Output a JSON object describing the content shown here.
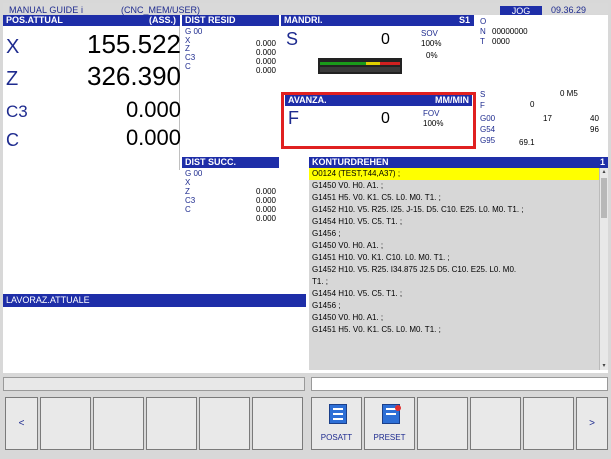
{
  "titlebar": {
    "title": "MANUAL GUIDE i",
    "mode": "(CNC_MEM/USER)",
    "jog": "JOG",
    "time": "09.36.29"
  },
  "pos": {
    "header": "POS.ATTUAL",
    "subheader": "(ASS.)",
    "axes": [
      {
        "label": "X",
        "value": "155.522"
      },
      {
        "label": "Z",
        "value": "326.390"
      },
      {
        "label": "C3",
        "value": "0.000"
      },
      {
        "label": "C",
        "value": "0.000"
      }
    ]
  },
  "dist_resid": {
    "header": "DIST RESID",
    "g": "G 00",
    "rows": [
      {
        "label": "X",
        "value": "0.000"
      },
      {
        "label": "Z",
        "value": "0.000"
      },
      {
        "label": "C3",
        "value": "0.000"
      },
      {
        "label": "C",
        "value": "0.000"
      }
    ]
  },
  "mandri": {
    "header": "MANDRI.",
    "s1": "S1",
    "s_label": "S",
    "s_value": "0",
    "sov": "SOV",
    "sov_pct": "100%",
    "load_pct": "0%"
  },
  "feed": {
    "header": "AVANZA.",
    "unit": "MM/MIN",
    "f_label": "F",
    "f_value": "0",
    "fov": "FOV",
    "fov_pct": "100%"
  },
  "right_info": {
    "o": "O",
    "n_label": "N",
    "n_value": "00000000",
    "t_label": "T",
    "t_value": "0000",
    "s_label": "S",
    "m_label": "0  M5",
    "f_label": "F",
    "f_value": "0",
    "g00": "G00",
    "v17": "17",
    "v40": "40",
    "g54": "G54",
    "v96": "96",
    "g95": "G95",
    "v691": "69.1"
  },
  "dist_succ": {
    "header": "DIST SUCC.",
    "g": "G 00",
    "rows": [
      {
        "label": "X",
        "value": "0.000"
      },
      {
        "label": "Z",
        "value": "0.000"
      },
      {
        "label": "C3",
        "value": "0.000"
      },
      {
        "label": "C",
        "value": "0.000"
      }
    ]
  },
  "program": {
    "header": "KONTURDREHEN",
    "page": "1",
    "lines": [
      "O0124 (TEST,T44,A37) ;",
      "G1450 V0. H0. A1. ;",
      "G1451 H5. V0. K1. C5. L0. M0. T1. ;",
      "G1452 H10. V5. R25. I25. J-15. D5. C10. E25. L0. M0. T1. ;",
      "G1454 H10. V5. C5. T1. ;",
      "G1456 ;",
      "G1450 V0. H0. A1. ;",
      "G1451 H10. V0. K1. C10. L0. M0. T1. ;",
      "G1452 H10. V5. R25. I34.875 J2.5 D5. C10. E25. L0. M0.",
      "T1. ;",
      "G1454 H10. V5. C5. T1. ;",
      "G1456 ;",
      "G1450 V0. H0. A1. ;",
      "G1451 H5. V0. K1. C5. L0. M0. T1. ;"
    ]
  },
  "lavoraz": {
    "header": "LAVORAZ.ATTUALE"
  },
  "softkeys": {
    "left_arrow": "<",
    "right_arrow": ">",
    "posatt": "POSATT",
    "preset": "PRESET"
  }
}
